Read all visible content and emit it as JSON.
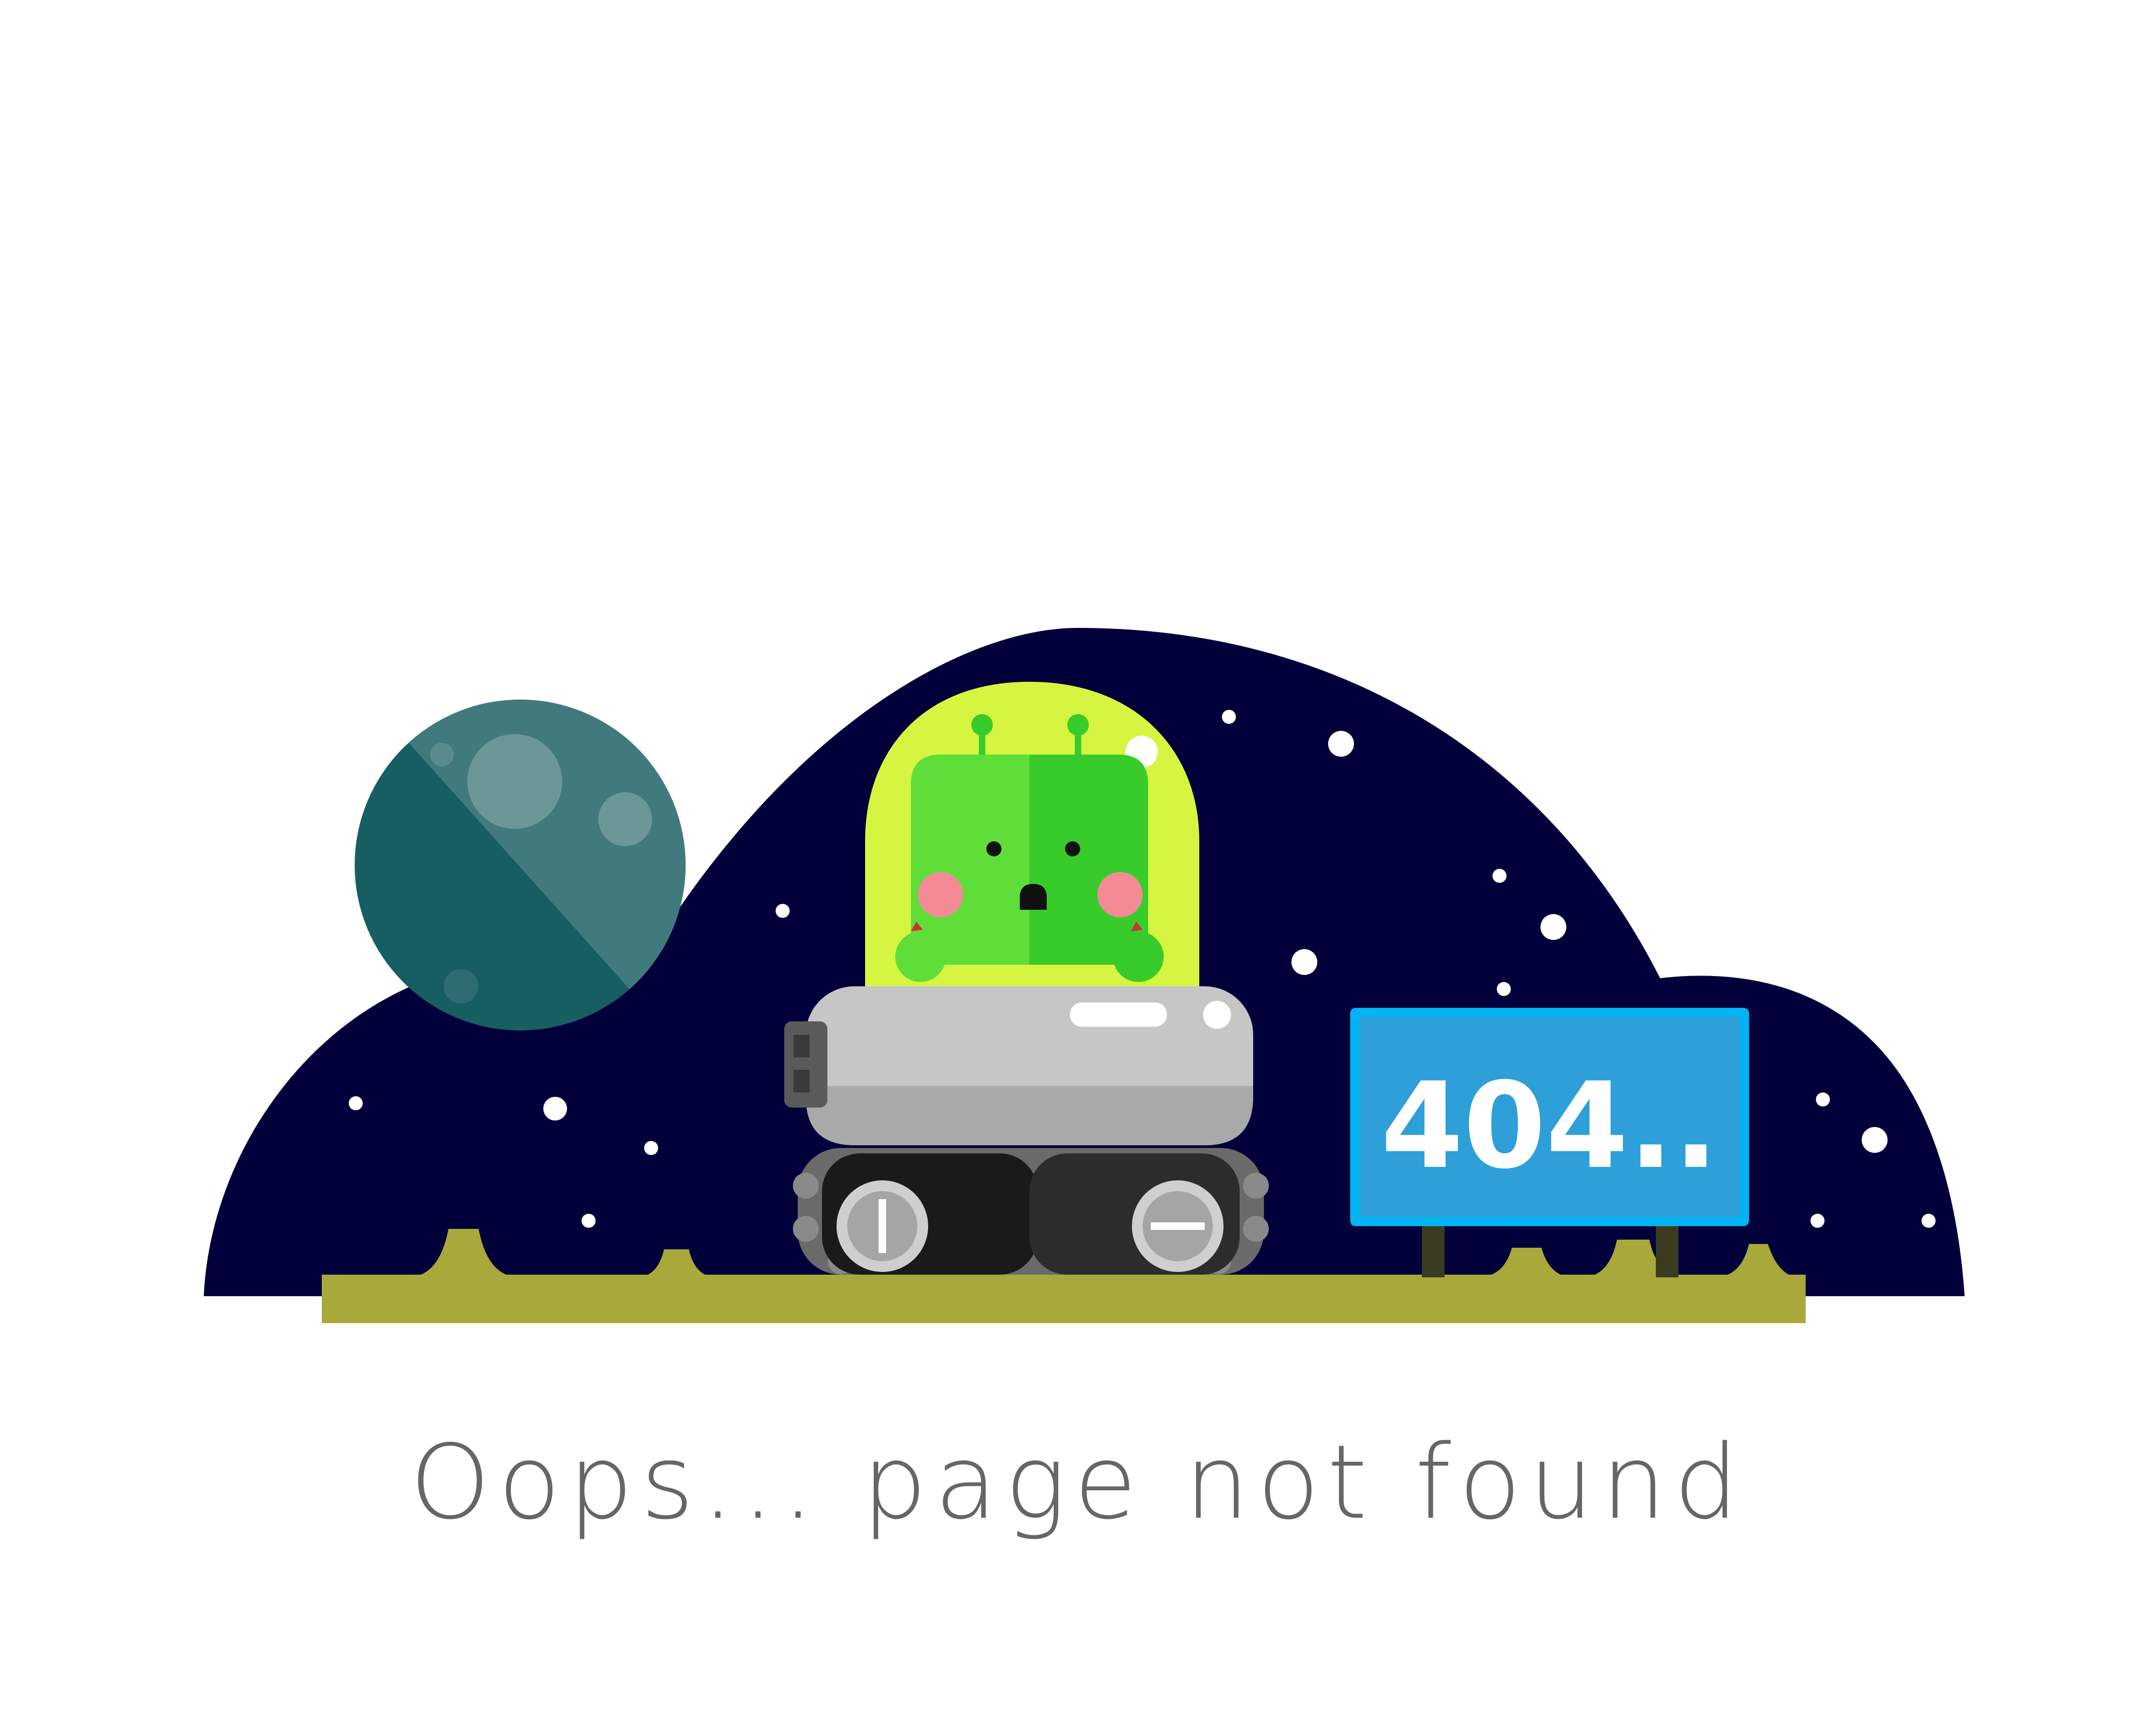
{
  "sign": {
    "label": "404.."
  },
  "message": {
    "text": "Oops... page not found"
  },
  "colors": {
    "background": "#ffffff",
    "sky": "#02003a",
    "ground": "#a9a83a",
    "planet_light": "#417a7c",
    "planet_dark": "#175e62",
    "dome": "#d6f540",
    "alien_light": "#5fdd38",
    "alien_dark": "#38cc2b",
    "cheek": "#f58a97",
    "rover_body": "#c6c6c6",
    "rover_dark": "#222222",
    "sign_face": "#2e9fd8",
    "sign_border": "#00b4f4",
    "message_text": "#666666"
  },
  "illustration": {
    "character": "alien-icon",
    "vehicle": "rover-icon",
    "planet": "planet-icon"
  }
}
